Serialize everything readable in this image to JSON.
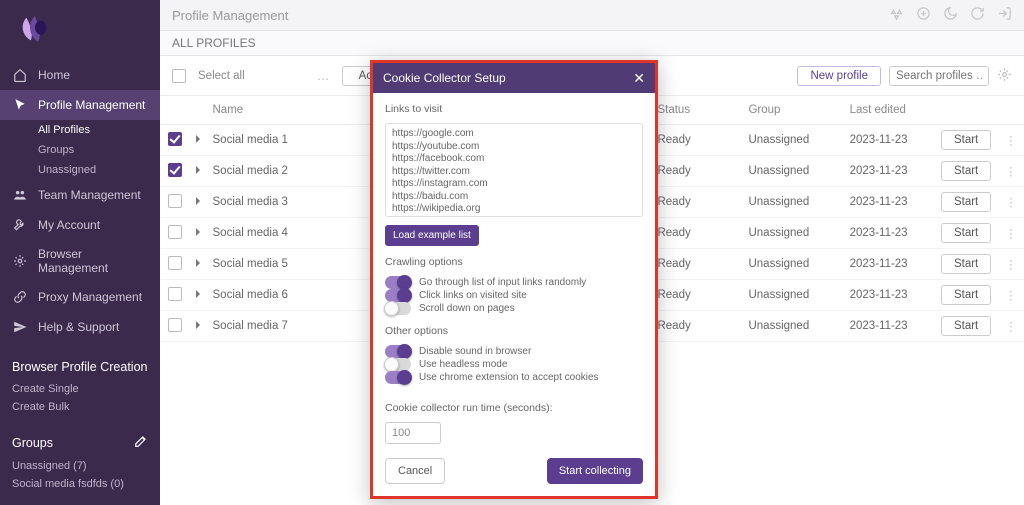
{
  "topbar": {
    "title": "Profile Management"
  },
  "subheader": {
    "label": "ALL PROFILES"
  },
  "toolbar": {
    "select_all": "Select all",
    "action": "Action",
    "dots": "…",
    "new_profile": "New profile",
    "search_placeholder": "Search profiles …"
  },
  "columns": {
    "name": "Name",
    "status": "Status",
    "group": "Group",
    "last_edited": "Last edited"
  },
  "rows": [
    {
      "checked": true,
      "name": "Social media 1",
      "status": "Ready",
      "group": "Unassigned",
      "edited": "2023-11-23",
      "action": "Start"
    },
    {
      "checked": true,
      "name": "Social media 2",
      "status": "Ready",
      "group": "Unassigned",
      "edited": "2023-11-23",
      "action": "Start"
    },
    {
      "checked": false,
      "name": "Social media 3",
      "status": "Ready",
      "group": "Unassigned",
      "edited": "2023-11-23",
      "action": "Start"
    },
    {
      "checked": false,
      "name": "Social media 4",
      "status": "Ready",
      "group": "Unassigned",
      "edited": "2023-11-23",
      "action": "Start"
    },
    {
      "checked": false,
      "name": "Social media 5",
      "status": "Ready",
      "group": "Unassigned",
      "edited": "2023-11-23",
      "action": "Start"
    },
    {
      "checked": false,
      "name": "Social media 6",
      "status": "Ready",
      "group": "Unassigned",
      "edited": "2023-11-23",
      "action": "Start"
    },
    {
      "checked": false,
      "name": "Social media 7",
      "status": "Ready",
      "group": "Unassigned",
      "edited": "2023-11-23",
      "action": "Start"
    }
  ],
  "sidebar": {
    "items": [
      {
        "label": "Home"
      },
      {
        "label": "Profile Management"
      },
      {
        "label": "Team Management"
      },
      {
        "label": "My Account"
      },
      {
        "label": "Browser Management"
      },
      {
        "label": "Proxy Management"
      },
      {
        "label": "Help & Support"
      }
    ],
    "subProfiles": [
      {
        "label": "All Profiles"
      },
      {
        "label": "Groups"
      },
      {
        "label": "Unassigned"
      }
    ],
    "bpc_title": "Browser Profile Creation",
    "bpc": [
      {
        "label": "Create Single"
      },
      {
        "label": "Create Bulk"
      }
    ],
    "groups_title": "Groups",
    "groups": [
      {
        "label": "Unassigned (7)"
      },
      {
        "label": "Social media fsdfds (0)"
      }
    ]
  },
  "modal": {
    "title": "Cookie Collector Setup",
    "links_label": "Links to visit",
    "links_value": "https://google.com\nhttps://youtube.com\nhttps://facebook.com\nhttps://twitter.com\nhttps://instagram.com\nhttps://baidu.com\nhttps://wikipedia.org\nhttps://yandex.ru\nhttps://yahoo.com",
    "load_example": "Load example list",
    "crawling_title": "Crawling options",
    "crawling": [
      {
        "label": "Go through list of input links randomly",
        "on": true
      },
      {
        "label": "Click links on visited site",
        "on": true
      },
      {
        "label": "Scroll down on pages",
        "on": false
      }
    ],
    "other_title": "Other options",
    "other": [
      {
        "label": "Disable sound in browser",
        "on": true
      },
      {
        "label": "Use headless mode",
        "on": false
      },
      {
        "label": "Use chrome extension to accept cookies",
        "on": true
      }
    ],
    "runtime_label": "Cookie collector run time (seconds):",
    "runtime_value": "100",
    "cancel": "Cancel",
    "start": "Start collecting"
  }
}
